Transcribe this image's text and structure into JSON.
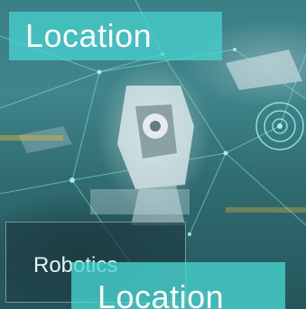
{
  "labels": {
    "top_badge": "Location",
    "card_label": "Robotics",
    "bottom_badge": "Location"
  },
  "colors": {
    "accent_teal": "#48d6d2",
    "background": "#3a7f86",
    "card_dark": "#1e3e44",
    "text": "#ffffff"
  },
  "icons": {
    "target": "target-rings-icon"
  }
}
